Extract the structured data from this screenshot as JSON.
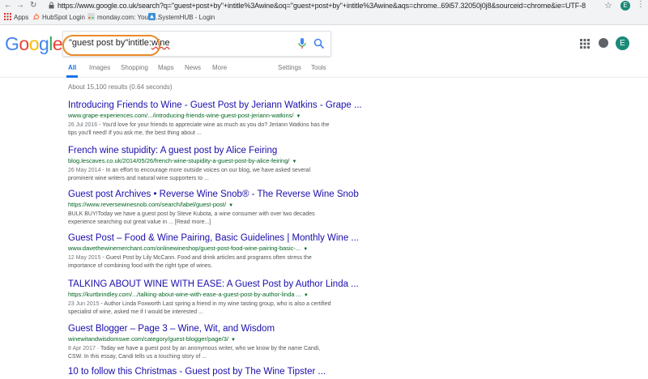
{
  "browser": {
    "url": "https://www.google.co.uk/search?q=\"guest+post+by\"+intitle%3Awine&oq=\"guest+post+by\"+intitle%3Awine&aqs=chrome..69i57.32050j0j8&sourceid=chrome&ie=UTF-8",
    "avatar_initial": "E",
    "bookmarks": [
      {
        "label": "Apps",
        "icon": "apps-grid-icon"
      },
      {
        "label": "HubSpot Login",
        "icon": "hubspot-icon"
      },
      {
        "label": "monday.com: Your t...",
        "icon": "monday-icon"
      },
      {
        "label": "SystemHUB - Login",
        "icon": "systemhub-icon"
      }
    ]
  },
  "google": {
    "logo": [
      "G",
      "o",
      "o",
      "g",
      "l",
      "e"
    ],
    "logo_colors": [
      "#4285f4",
      "#ea4335",
      "#fbbc05",
      "#4285f4",
      "#34a853",
      "#ea4335"
    ],
    "query_prefix": "\"guest post by\"intitle:",
    "query_suffix": "wine",
    "avatar_initial": "E",
    "highlight_color": "#ec8a2a"
  },
  "tabs": [
    "All",
    "Images",
    "Shopping",
    "Maps",
    "News",
    "More",
    "Settings",
    "Tools"
  ],
  "stats": "About 15,100 results (0.64 seconds)",
  "results": [
    {
      "title": "Introducing Friends to Wine - Guest Post by Jeriann Watkins - Grape ...",
      "url": "www.grape-experiences.com/.../introducing-friends-wine-guest-post-jeriann-watkins/",
      "date": "26 Jul 2016",
      "snippet": " - You'd love for your friends to appreciate wine as much as you do? Jeriann Watkins has the tips you'll need! If you ask me, the best thing about ..."
    },
    {
      "title": "French wine stupidity: A guest post by Alice Feiring",
      "url": "blog.lescaves.co.uk/2014/05/26/french-wine-stupidity-a-guest-post-by-alice-feiring/",
      "date": "26 May 2014",
      "snippet": " - In an effort to encourage more outside voices on our blog, we have asked several prominent wine writers and natural wine supporters to ..."
    },
    {
      "title": "Guest post Archives • Reverse Wine Snob® - The Reverse Wine Snob",
      "url": "https://www.reversewinesnob.com/search/label/guest-post/",
      "date": "",
      "snippet": "BULK BUY!Today we have a guest post by Steve Kubota, a wine consumer with over two decades experience searching out great value in ... [Read more...]"
    },
    {
      "title": "Guest Post – Food & Wine Pairing, Basic Guidelines | Monthly Wine ...",
      "url": "www.davethewinemerchant.com/onlinewineshop/guest-post-food-wine-pairing-basic-...",
      "date": "12 May 2015",
      "snippet": " - Guest Post by Lily McCann. Food and drink articles and programs often stress the importance of combining food with the right type of wines."
    },
    {
      "title": "TALKING ABOUT WINE WITH EASE: A Guest Post by Author Linda ...",
      "url": "https://kurtbrindley.com/.../talking-about-wine-with-ease-a-guest-post-by-author-linda ...",
      "date": "23 Jun 2015",
      "snippet": " - Author Linda Foxworth Last spring a friend in my wine tasting group, who is also a certified specialist of wine, asked me if I would be interested ..."
    },
    {
      "title": "Guest Blogger – Page 3 – Wine, Wit, and Wisdom",
      "url": "winewitandwisdomswe.com/category/guest-blogger/page/3/",
      "date": "8 Apr 2017",
      "snippet": " · Today we have a guest post by an anonymous writer, who we know by the name Candi, CSW. In this essay, Candi tells us a touching story of ..."
    },
    {
      "title": "10 to follow this Christmas - Guest post by The Wine Tipster ...",
      "url": "",
      "date": "",
      "snippet": ""
    }
  ]
}
